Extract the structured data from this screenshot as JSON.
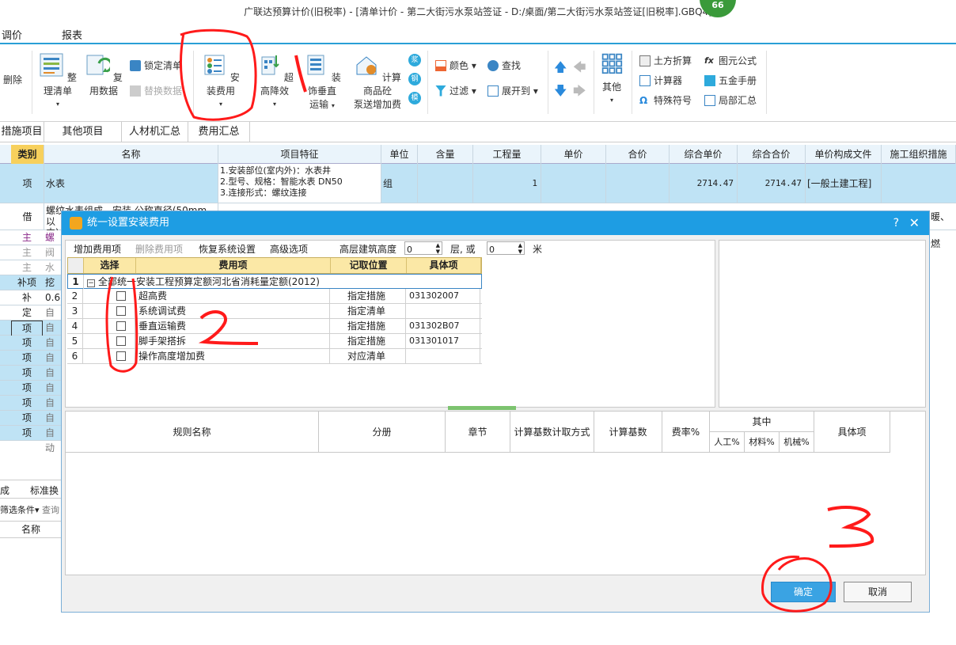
{
  "window": {
    "title": "广联达预算计价(旧税率) - [清单计价 - 第二大街污水泵站签证 - D:/桌面/第二大街污水泵站签证[旧税率].GBQ4]",
    "badge": "66"
  },
  "menu": [
    "调价",
    "报表"
  ],
  "ribbon": {
    "delete": "删除",
    "organize": "整理清单",
    "reuse": "复用数据",
    "lock": "锁定清单",
    "replace": "替换数据",
    "install_fee": "安装费用",
    "super_high": "超高降效",
    "decor_vertical": "装饰垂直",
    "transport": "运输",
    "calc_concrete": "计算商品砼",
    "pump_fee": "泵送增加费",
    "c1": "浆",
    "c2": "钢",
    "c3": "模",
    "color": "颜色",
    "find": "查找",
    "filter": "过滤",
    "expand": "展开到",
    "other": "其他",
    "earth": "土方折算",
    "formula": "图元公式",
    "calculator": "计算器",
    "hardware": "五金手册",
    "special": "特殊符号",
    "partial": "局部汇总"
  },
  "subtabs": [
    "措施项目",
    "其他项目",
    "人材机汇总",
    "费用汇总"
  ],
  "grid": {
    "headers": [
      "类别",
      "名称",
      "项目特征",
      "单位",
      "含量",
      "工程量",
      "单价",
      "合价",
      "综合单价",
      "综合合价",
      "单价构成文件",
      "施工组织措施"
    ],
    "row1": {
      "type": "项",
      "name": "水表",
      "feature1": "1.安装部位(室内外)：水表井",
      "feature2": "2.型号、规格：智能水表 DN50",
      "feature3": "3.连接形式：螺纹连接",
      "unit": "组",
      "qty": "1",
      "unit_total": "2714.47",
      "total": "2714.47",
      "file": "[一般土建工程]"
    },
    "row2": {
      "type": "借",
      "name1": "螺纹水表组成、安装 公称直径(50mm以",
      "name2": "内)",
      "tail": "暖、燃"
    },
    "rows": [
      {
        "type": "主",
        "name": "螺纹"
      },
      {
        "type": "主",
        "name": "阀门"
      },
      {
        "type": "主",
        "name": "水表"
      },
      {
        "type": "补项",
        "name": "挖掘"
      },
      {
        "type": "补",
        "name": "0.6"
      },
      {
        "type": "定",
        "name": "自动"
      },
      {
        "type": "项",
        "name": "自动"
      },
      {
        "type": "项",
        "name": "自动"
      },
      {
        "type": "项",
        "name": "自动"
      },
      {
        "type": "项",
        "name": "自动"
      },
      {
        "type": "项",
        "name": "自动"
      },
      {
        "type": "项",
        "name": "自动"
      },
      {
        "type": "项",
        "name": "自动"
      },
      {
        "type": "项",
        "name": "自动"
      }
    ]
  },
  "bottom_left": {
    "tab1": "成",
    "tab2": "标准换",
    "filter": "筛选条件",
    "query": "查询",
    "name": "名称"
  },
  "dialog": {
    "title": "统一设置安装费用",
    "help": "?",
    "close": "✕",
    "toolbar": {
      "add": "增加费用项",
      "delete": "删除费用项",
      "restore": "恢复系统设置",
      "advanced": "高级选项",
      "height_label": "高层建筑高度",
      "floors_val": "0",
      "floors_unit": "层, 或",
      "meters_val": "0",
      "meters_unit": "米"
    },
    "fee_headers": [
      "选择",
      "费用项",
      "记取位置",
      "具体项"
    ],
    "fee_group": {
      "num": "1",
      "label": "全部统一安装工程预算定额河北省消耗量定额(2012)"
    },
    "fees": [
      {
        "num": "2",
        "name": "超高费",
        "pos": "指定措施",
        "item": "031302007"
      },
      {
        "num": "3",
        "name": "系统调试费",
        "pos": "指定清单",
        "item": ""
      },
      {
        "num": "4",
        "name": "垂直运输费",
        "pos": "指定措施",
        "item": "031302B07"
      },
      {
        "num": "5",
        "name": "脚手架搭拆",
        "pos": "指定措施",
        "item": "031301017"
      },
      {
        "num": "6",
        "name": "操作高度增加费",
        "pos": "对应清单",
        "item": ""
      }
    ],
    "rule_headers": {
      "rule": "规则名称",
      "volume": "分册",
      "chapter": "章节",
      "method": "计算基数计取方式",
      "base": "计算基数",
      "rate": "费率%",
      "among": "其中",
      "labor": "人工%",
      "material": "材料%",
      "machine": "机械%",
      "item": "具体项"
    },
    "ok": "确定",
    "cancel": "取消"
  },
  "annotations": {
    "n1": "1",
    "n2": "2",
    "n3": "3"
  },
  "colors": {
    "accent": "#1e9de3",
    "annotation": "#ff0000",
    "header_yellow": "#fbe8a6",
    "row_blue": "#bfe3f5"
  }
}
